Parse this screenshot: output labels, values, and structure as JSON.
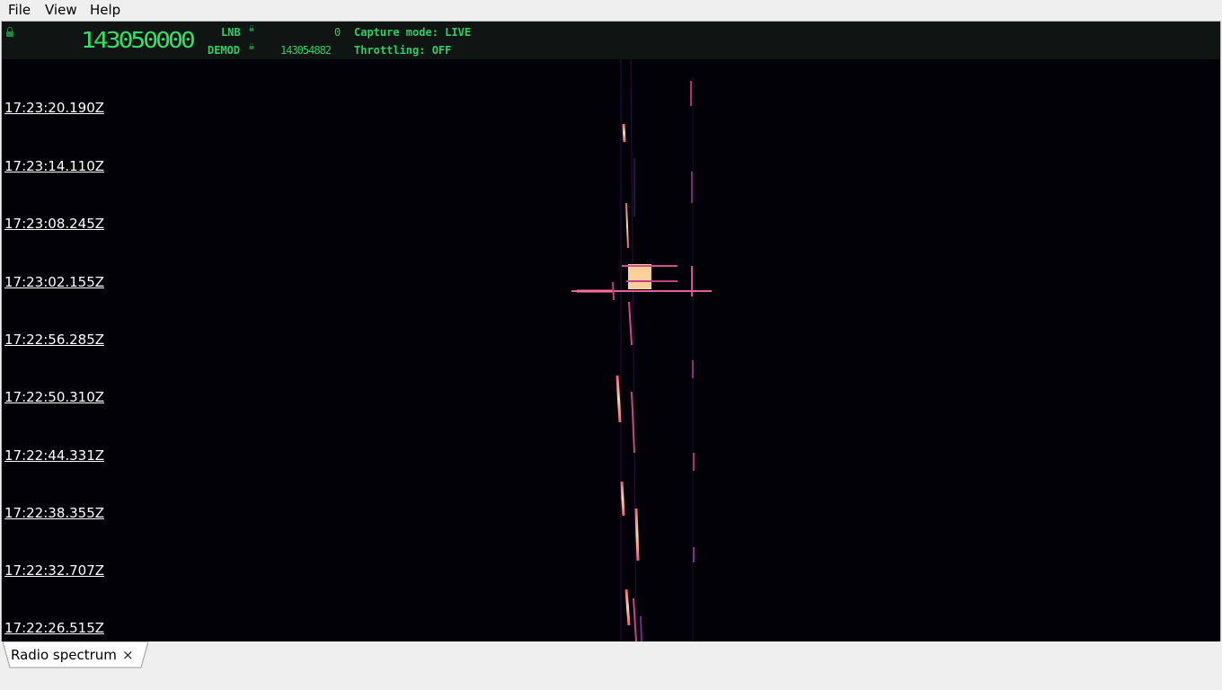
{
  "menu": {
    "file": "File",
    "view": "View",
    "help": "Help"
  },
  "status": {
    "main_frequency": "143050000",
    "lnb_label": "LNB",
    "lnb_value": "0",
    "demod_label": "DEMOD",
    "demod_value": "143054882",
    "capture_mode": "Capture mode: LIVE",
    "throttling": "Throttling: OFF"
  },
  "timestamps": [
    "17:23:20.190Z",
    "17:23:14.110Z",
    "17:23:08.245Z",
    "17:23:02.155Z",
    "17:22:56.285Z",
    "17:22:50.310Z",
    "17:22:44.331Z",
    "17:22:38.355Z",
    "17:22:32.707Z",
    "17:22:26.515Z"
  ],
  "tab": {
    "label": "Radio spectrum",
    "close": "×"
  },
  "colors": {
    "accent": "#33cc66",
    "waterfall_bg": "#020107",
    "signal_hot": "#ffd6a0",
    "signal_warm": "#e8607a",
    "signal_cool": "#6b2a8a"
  }
}
